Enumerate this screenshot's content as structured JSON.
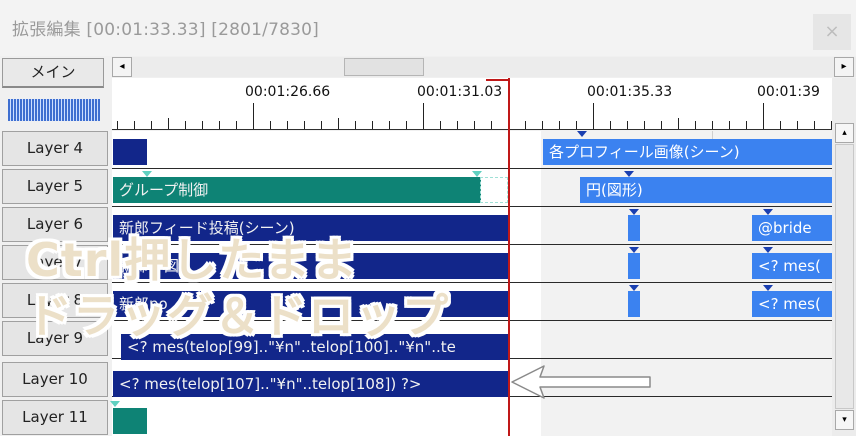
{
  "window": {
    "title": "拡張編集 [00:01:33.33] [2801/7830]",
    "close_glyph": "×"
  },
  "scene_button": {
    "label": "メイン"
  },
  "scrollbar": {
    "left_arrow": "◂",
    "right_arrow": "▸",
    "up_arrow": "▴",
    "down_arrow": "▾"
  },
  "ruler": {
    "labels": [
      "00:01:26.66",
      "00:01:31.03",
      "00:01:35.33",
      "00:01:39"
    ]
  },
  "layers": [
    {
      "label": "Layer 4"
    },
    {
      "label": "Layer 5"
    },
    {
      "label": "Layer 6"
    },
    {
      "label": "Layer 7"
    },
    {
      "label": "Layer 8"
    },
    {
      "label": "Layer 9"
    },
    {
      "label": "Layer 10"
    },
    {
      "label": "Layer 11"
    }
  ],
  "clips": {
    "l4_right": "各プロフィール画像(シーン)",
    "l5_left": "グループ制御",
    "l5_right": "円(図形)",
    "l6_left": "新郎フィード投稿(シーン)",
    "l6_right": "@bride",
    "l7_left": "新郎フ図",
    "l7_right": "<? mes(",
    "l8_left": "新郎po",
    "l8_right": "<? mes(",
    "l9": "<? mes(telop[99]..\"¥n\"..telop[100]..\"¥n\"..te",
    "l10": "<? mes(telop[107]..\"¥n\"..telop[108]) ?>"
  },
  "overlay": {
    "line1": "Ctrl押したまま",
    "line2": "ドラッグ＆ドロップ"
  },
  "colors": {
    "navy_clip": "#12268a",
    "blue_clip": "#3b82f0",
    "teal_clip": "#0e8375",
    "cursor": "#c01818"
  }
}
